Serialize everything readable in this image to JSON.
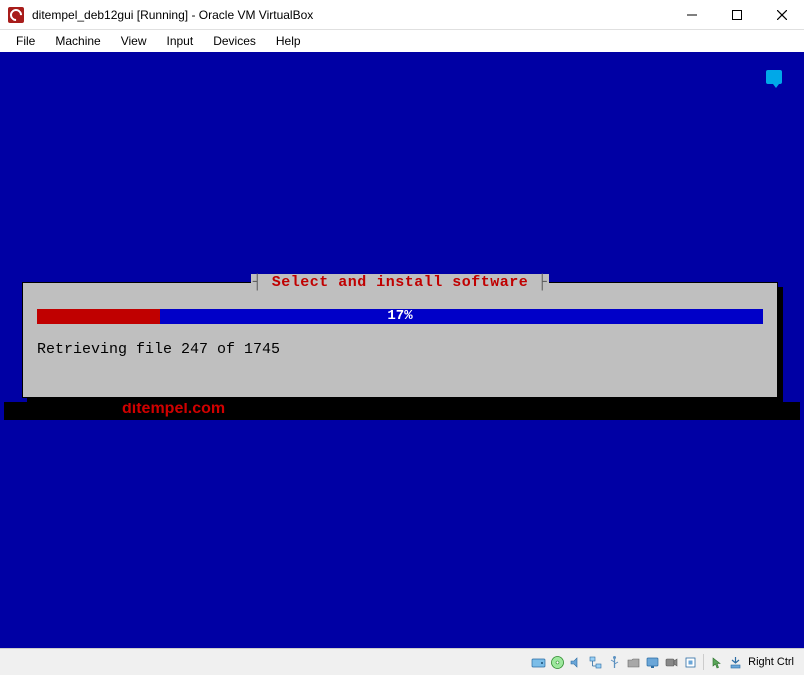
{
  "titlebar": {
    "title": "ditempel_deb12gui [Running] - Oracle VM VirtualBox"
  },
  "menu": {
    "file": "File",
    "machine": "Machine",
    "view": "View",
    "input": "Input",
    "devices": "Devices",
    "help": "Help"
  },
  "installer": {
    "title": "Select and install software",
    "progress_percent": 17,
    "progress_label": "17%",
    "status": "Retrieving file 247 of 1745"
  },
  "watermark": "ditempel.com",
  "statusbar": {
    "host_key": "Right Ctrl",
    "icons": {
      "harddisk": "harddisk-icon",
      "optical": "optical-icon",
      "audio": "audio-icon",
      "network": "network-icon",
      "usb": "usb-icon",
      "shared": "shared-folder-icon",
      "display": "display-icon",
      "recording": "recording-icon",
      "cpu": "cpu-icon",
      "mouse": "mouse-icon",
      "keyboard": "keyboard-icon"
    }
  }
}
